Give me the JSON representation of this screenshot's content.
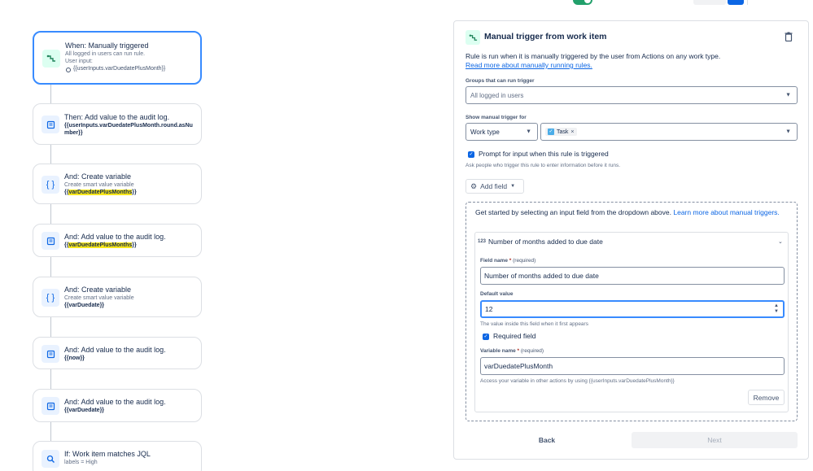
{
  "header": {
    "label": "",
    "button_label": ""
  },
  "flow": {
    "cards": [
      {
        "title": "When: Manually triggered",
        "sub": "All logged in users can run rule.",
        "sub2": "User input:",
        "bullet": "{{userInputs.varDuedatePlusMonth}}",
        "icon": "trigger-icon"
      },
      {
        "title": "Then: Add value to the audit log.",
        "code": "{{userInputs.varDuedatePlusMonth.round.asNumber}}",
        "icon": "audit-log-icon"
      },
      {
        "title": "And: Create variable",
        "sub": "Create smart value variable",
        "code_prefix": "{{",
        "code_hl": "varDuedatePlusMonths",
        "code_suffix": "}}",
        "icon": "variable-icon"
      },
      {
        "title": "And: Add value to the audit log.",
        "code_prefix": "{{",
        "code_hl": "varDuedatePlusMonths",
        "code_suffix": "}}",
        "icon": "audit-log-icon"
      },
      {
        "title": "And: Create variable",
        "sub": "Create smart value variable",
        "code": "{{varDuedate}}",
        "icon": "variable-icon"
      },
      {
        "title": "And: Add value to the audit log.",
        "code": "{{now}}",
        "icon": "audit-log-icon"
      },
      {
        "title": "And: Add value to the audit log.",
        "code": "{{varDuedate}}",
        "icon": "audit-log-icon"
      },
      {
        "title": "If: Work item matches JQL",
        "sub": "labels = High",
        "icon": "search-icon"
      }
    ]
  },
  "panel": {
    "title": "Manual trigger from work item",
    "description": "Rule is run when it is manually triggered by the user from Actions on any work type.",
    "link": "Read more about manually running rules.",
    "groups_label": "Groups that can run trigger",
    "groups_value": "All logged in users",
    "show_label": "Show manual trigger for",
    "work_type_select": "Work type",
    "task_chip": "Task",
    "prompt_checkbox_label": "Prompt for input when this rule is triggered",
    "prompt_note": "Ask people who trigger this rule to enter information before it runs.",
    "add_field_label": "Add field",
    "get_started_text": "Get started by selecting an input field from the dropdown above.",
    "get_started_link": "Learn more about manual triggers.",
    "field_badge": "123",
    "field_header": "Number of months added to due date",
    "field_name_label": "Field name",
    "required_label": "(required)",
    "field_name_value": "Number of months added to due date",
    "default_value_label": "Default value",
    "default_value": "12",
    "default_note": "The value inside this field when it first appears",
    "required_field_label": "Required field",
    "variable_name_label": "Variable name",
    "variable_name_value": "varDuedatePlusMonth",
    "variable_note": "Access your variable in other actions by using {{userInputs.varDuedatePlusMonth}}",
    "remove_label": "Remove",
    "back_label": "Back",
    "next_label": "Next"
  }
}
